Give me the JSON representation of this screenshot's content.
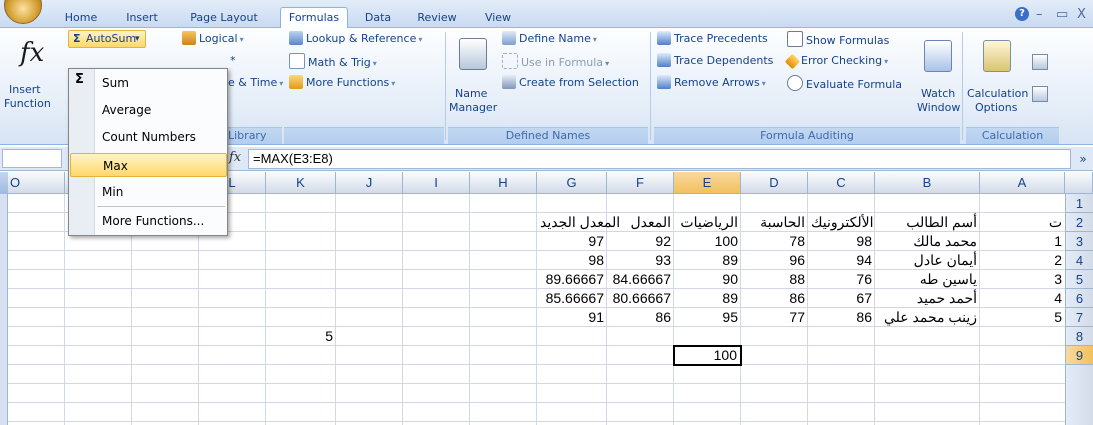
{
  "tabs": [
    "Home",
    "Insert",
    "Page Layout",
    "Formulas",
    "Data",
    "Review",
    "View"
  ],
  "window_controls": [
    "?",
    "–",
    "▭",
    "X"
  ],
  "ribbon": {
    "insert_function": {
      "line1": "Insert",
      "line2": "Function"
    },
    "autosum": {
      "label": "AutoSum"
    },
    "logical": "Logical",
    "partial_a": "*",
    "date_time_partial": "e & Time",
    "library_label_partial": "Library",
    "lookup": "Lookup & Reference",
    "math_trig": "Math & Trig",
    "more_functions": "More Functions",
    "name_manager": {
      "line1": "Name",
      "line2": "Manager"
    },
    "define_name": "Define Name",
    "use_in_formula": "Use in Formula",
    "create_from_selection": "Create from Selection",
    "defined_names_label": "Defined Names",
    "trace_precedents": "Trace Precedents",
    "trace_dependents": "Trace Dependents",
    "remove_arrows": "Remove Arrows",
    "show_formulas": "Show Formulas",
    "error_checking": "Error Checking",
    "evaluate_formula": "Evaluate Formula",
    "formula_auditing_label": "Formula Auditing",
    "watch_window": {
      "line1": "Watch",
      "line2": "Window"
    },
    "calc_options": {
      "line1": "Calculation",
      "line2": "Options"
    },
    "calculation_label": "Calculation"
  },
  "autosum_menu": [
    "Sum",
    "Average",
    "Count Numbers",
    "Max",
    "Min",
    "More Functions..."
  ],
  "formula_bar": {
    "fx": "fx",
    "formula": "=MAX(E3:E8)"
  },
  "columns": [
    "A",
    "B",
    "C",
    "D",
    "E",
    "F",
    "G",
    "H",
    "I",
    "J",
    "K",
    "L",
    "",
    "",
    "",
    "O"
  ],
  "rows": [
    "1",
    "2",
    "3",
    "4",
    "5",
    "6",
    "7",
    "8",
    "9"
  ],
  "headers_row2": {
    "A": "ت",
    "B": "أسم الطالب",
    "C": "الألكترونيك",
    "D": "الحاسبة",
    "E": "الرياضيات",
    "F": "المعدل",
    "G": "المعدل الجديد"
  },
  "data_rows": [
    {
      "A": "1",
      "B": "محمد مالك",
      "C": "98",
      "D": "78",
      "E": "100",
      "F": "92",
      "G": "97"
    },
    {
      "A": "2",
      "B": "أيمان عادل",
      "C": "94",
      "D": "96",
      "E": "89",
      "F": "93",
      "G": "98"
    },
    {
      "A": "3",
      "B": "ياسين طه",
      "C": "76",
      "D": "88",
      "E": "90",
      "F": "84.66667",
      "G": "89.66667"
    },
    {
      "A": "4",
      "B": "أحمد حميد",
      "C": "67",
      "D": "86",
      "E": "89",
      "F": "80.66667",
      "G": "85.66667"
    },
    {
      "A": "5",
      "B": "زينب محمد علي",
      "C": "86",
      "D": "77",
      "E": "95",
      "F": "86",
      "G": "91"
    }
  ],
  "row8_K": "5",
  "row9_E": "100",
  "accent": {
    "ribbon": "#dbe6f4",
    "selected_header": "#f1c15f",
    "menu_highlight": "#ffd86b"
  }
}
